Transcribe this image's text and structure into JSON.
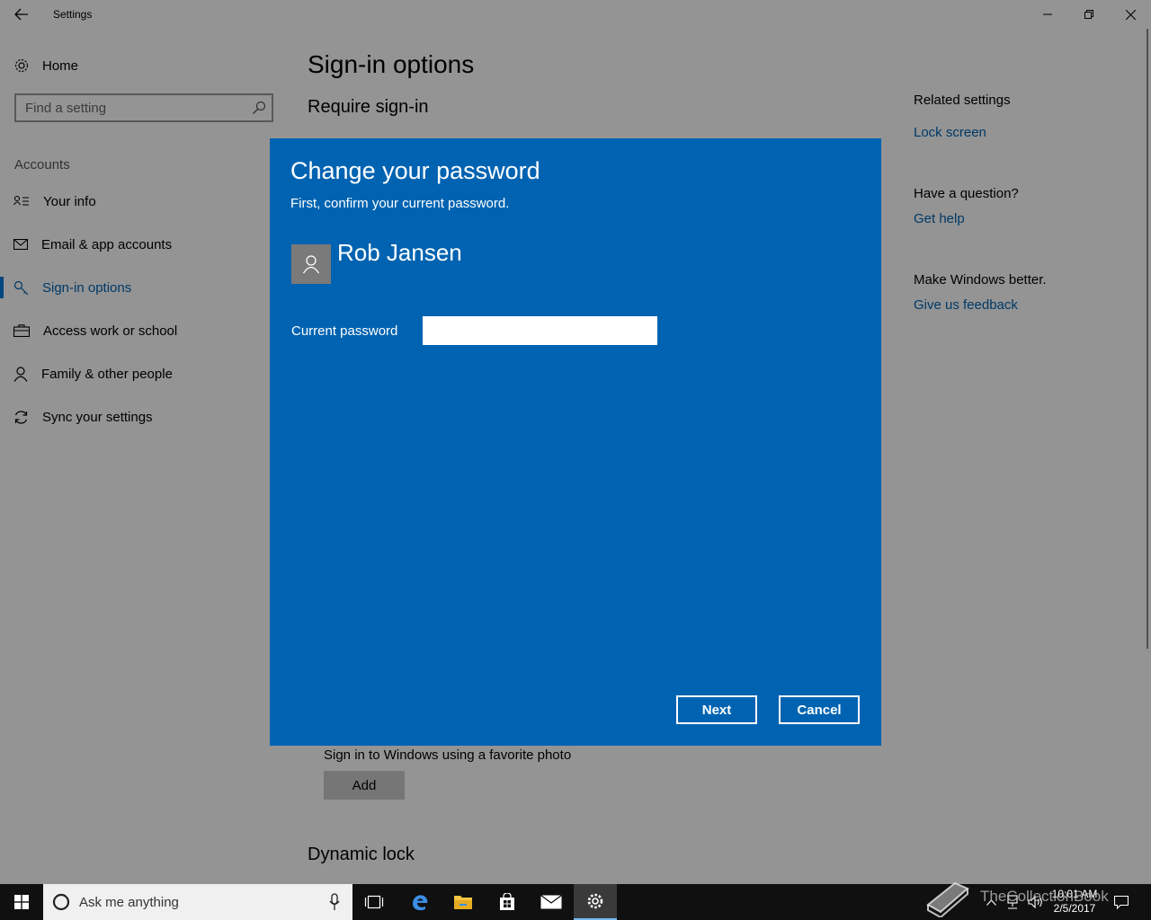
{
  "window": {
    "title": "Settings"
  },
  "sidebar": {
    "home_label": "Home",
    "search_placeholder": "Find a setting",
    "section_label": "Accounts",
    "items": [
      {
        "label": "Your info"
      },
      {
        "label": "Email & app accounts"
      },
      {
        "label": "Sign-in options",
        "selected": true
      },
      {
        "label": "Access work or school"
      },
      {
        "label": "Family & other people"
      },
      {
        "label": "Sync your settings"
      }
    ]
  },
  "main": {
    "page_title": "Sign-in options",
    "require_signin_heading": "Require sign-in",
    "picture_password_text": "Sign in to Windows using a favorite photo",
    "add_button": "Add",
    "dynamic_lock_heading": "Dynamic lock"
  },
  "right_rail": {
    "related_heading": "Related settings",
    "lock_screen_link": "Lock screen",
    "question_heading": "Have a question?",
    "get_help_link": "Get help",
    "feedback_heading": "Make Windows better.",
    "feedback_link": "Give us feedback"
  },
  "dialog": {
    "title": "Change your password",
    "subtitle": "First, confirm your current password.",
    "user_name": "Rob Jansen",
    "current_password_label": "Current password",
    "current_password_value": "",
    "next_button": "Next",
    "cancel_button": "Cancel"
  },
  "taskbar": {
    "search_placeholder": "Ask me anything",
    "time": "10:01 AM",
    "date": "2/5/2017"
  },
  "watermark": {
    "text": "TheCollectionBook"
  },
  "colors": {
    "accent": "#0063b1",
    "dialog_background": "#0063b1",
    "link": "#0063b1",
    "taskbar": "#101010"
  }
}
